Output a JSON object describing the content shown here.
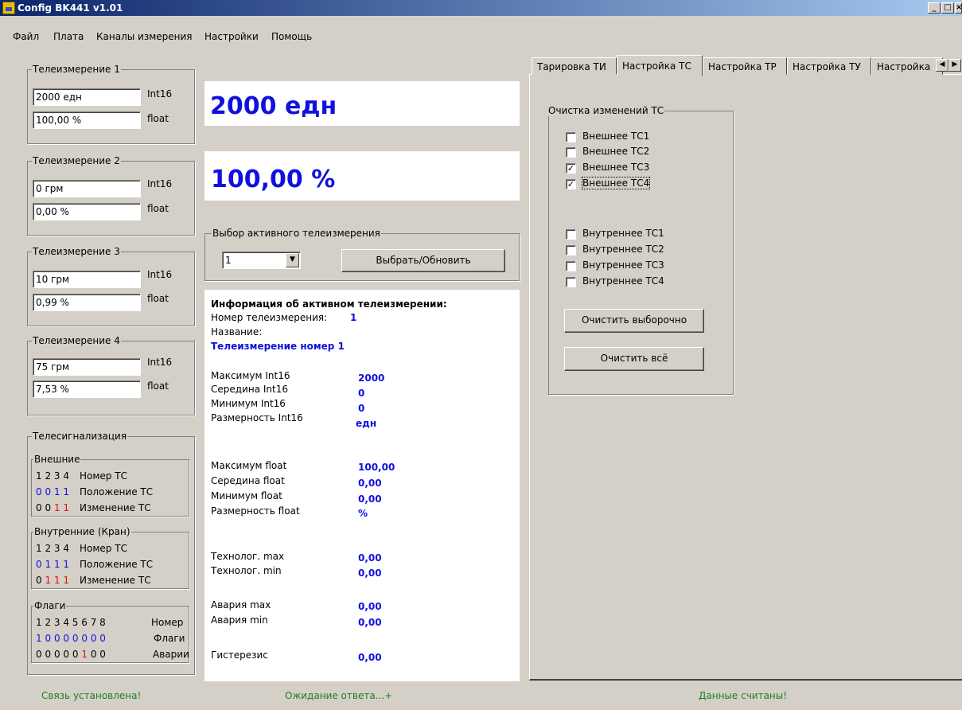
{
  "window": {
    "title": "Config BK441 v1.01",
    "min": "_",
    "max": "□",
    "close": "×"
  },
  "menu": [
    "Файл",
    "Плата",
    "Каналы измерения",
    "Настройки",
    "Помощь"
  ],
  "tm": [
    {
      "title": "Телеизмерение 1",
      "int_value": "2000 едн",
      "float_value": "100,00 %"
    },
    {
      "title": "Телеизмерение 2",
      "int_value": "0 грм",
      "float_value": "0,00 %"
    },
    {
      "title": "Телеизмерение 3",
      "int_value": "10 грм",
      "float_value": "0,99 %"
    },
    {
      "title": "Телеизмерение 4",
      "int_value": "75 грм",
      "float_value": "7,53 %"
    }
  ],
  "type_labels": {
    "int": "Int16",
    "float": "float"
  },
  "big": {
    "int": "2000 едн",
    "float": "100,00 %"
  },
  "select": {
    "title": "Выбор активного телеизмерения",
    "value": "1",
    "button": "Выбрать/Обновить"
  },
  "info": {
    "header": "Информация об активном телеизмерении:",
    "number_label": "Номер телеизмерения:",
    "number": "1",
    "name_label": "Название:",
    "name": "Телеизмерение номер 1",
    "rows": [
      {
        "label": "Максимум Int16",
        "value": "2000"
      },
      {
        "label": "Середина Int16",
        "value": "0"
      },
      {
        "label": "Минимум Int16",
        "value": "0"
      },
      {
        "label": "Размерность Int16",
        "value": "едн"
      },
      {
        "label": "Максимум float",
        "value": "100,00"
      },
      {
        "label": "Середина float",
        "value": "0,00"
      },
      {
        "label": "Минимум float",
        "value": "0,00"
      },
      {
        "label": "Размерность float",
        "value": "%"
      },
      {
        "label": "Технолог. max",
        "value": "0,00"
      },
      {
        "label": "Технолог. min",
        "value": "0,00"
      },
      {
        "label": "Авария max",
        "value": "0,00"
      },
      {
        "label": "Авария min",
        "value": "0,00"
      },
      {
        "label": "Гистерезис",
        "value": "0,00"
      }
    ]
  },
  "ts": {
    "title": "Телесигнализация",
    "ext": {
      "title": "Внешние",
      "nums": "1 2 3 4",
      "num_label": "Номер ТС",
      "pos_label": "Положение ТС",
      "chg_label": "Изменение ТС",
      "pos": [
        "0",
        "0",
        "1",
        "1"
      ],
      "chg": [
        "0",
        "0",
        "1",
        "1"
      ]
    },
    "int": {
      "title": "Внутренние (Кран)",
      "nums": "1 2 3 4",
      "num_label": "Номер ТС",
      "pos_label": "Положение ТС",
      "chg_label": "Изменение ТС",
      "pos": [
        "0",
        "1",
        "1",
        "1"
      ],
      "chg": [
        "0",
        "1",
        "1",
        "1"
      ]
    },
    "flags": {
      "title": "Флаги",
      "nums": "1 2 3 4 5 6 7 8",
      "num_label": "Номер",
      "flags_label": "Флаги",
      "alarm_label": "Аварии",
      "flags": [
        "1",
        "0",
        "0",
        "0",
        "0",
        "0",
        "0",
        "0"
      ],
      "alarms": [
        "0",
        "0",
        "0",
        "0",
        "0",
        "1",
        "0",
        "0"
      ]
    }
  },
  "tabs": [
    "Тарировка ТИ",
    "Настройка ТС",
    "Настройка ТР",
    "Настройка ТУ",
    "Настройка"
  ],
  "clear": {
    "title": "Очистка изменений ТС",
    "ext": [
      {
        "label": "Внешнее ТС1",
        "checked": false
      },
      {
        "label": "Внешнее ТС2",
        "checked": false
      },
      {
        "label": "Внешнее ТС3",
        "checked": true
      },
      {
        "label": "Внешнее ТС4",
        "checked": true
      }
    ],
    "int": [
      {
        "label": "Внутреннее ТС1",
        "checked": false
      },
      {
        "label": "Внутреннее ТС2",
        "checked": false
      },
      {
        "label": "Внутреннее ТС3",
        "checked": false
      },
      {
        "label": "Внутреннее ТС4",
        "checked": false
      }
    ],
    "btn_selective": "Очистить выборочно",
    "btn_all": "Очистить всё",
    "check_mark": "✓"
  },
  "status": {
    "left": "Связь установлена!",
    "mid": "Ожидание ответа...+",
    "right": "Данные считаны!"
  }
}
